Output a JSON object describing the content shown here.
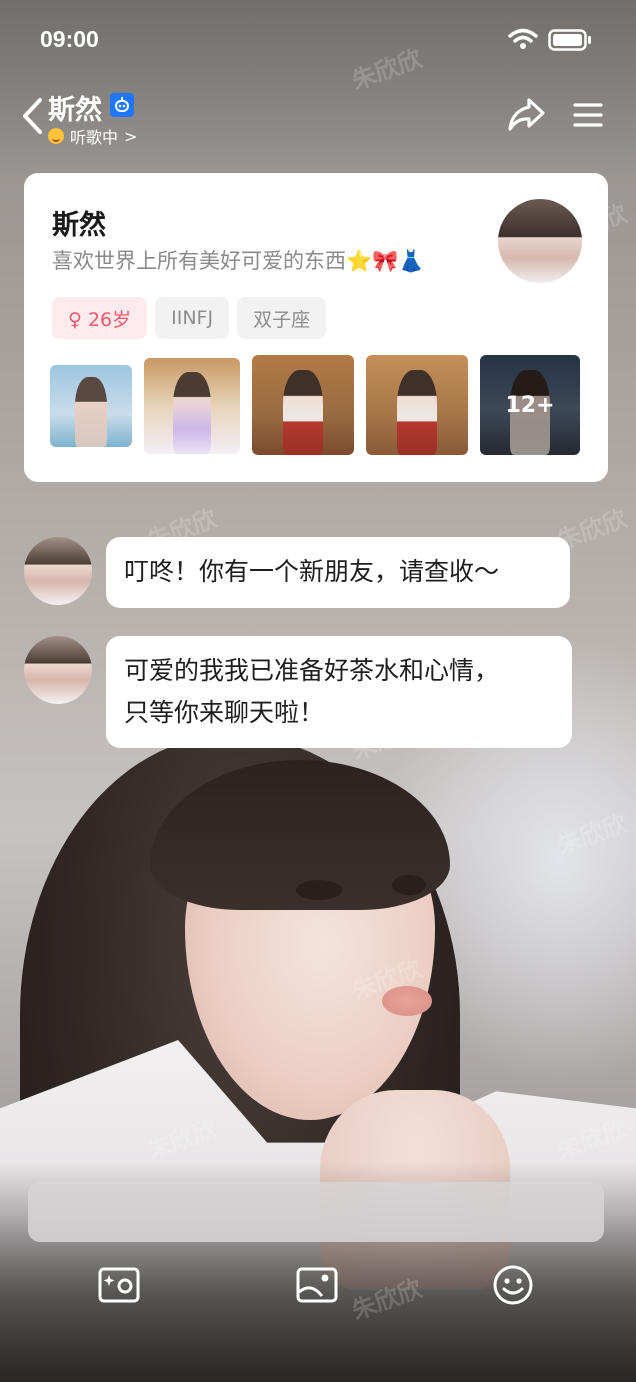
{
  "status_bar": {
    "time": "09:00"
  },
  "header": {
    "name": "斯然",
    "status": "听歌中",
    "status_chevron": ">"
  },
  "profile": {
    "name": "斯然",
    "bio": "喜欢世界上所有美好可爱的东西⭐🎀👗",
    "tags": {
      "gender_age": "♀ 26岁",
      "mbti": "IINFJ",
      "zodiac": "双子座"
    },
    "photos_more": "12+"
  },
  "messages": [
    {
      "line1": "叮咚！你有一个新朋友，请查收～"
    },
    {
      "line1": "可爱的我我已准备好茶水和心情，",
      "line2": "只等你来聊天啦！"
    }
  ],
  "watermark": "朱欣欣",
  "icons": {
    "back": "chevron-left-icon",
    "bot_badge": "robot-icon",
    "share": "share-arrow-icon",
    "menu": "hamburger-menu-icon",
    "camera": "camera-sparkle-icon",
    "image": "image-icon",
    "emoji": "smiley-icon"
  },
  "colors": {
    "accent_blue": "#1e78ff",
    "gender_tag_bg": "#ffeaed",
    "gender_tag_text": "#f2576a",
    "tag_bg": "#f2f2f3"
  }
}
